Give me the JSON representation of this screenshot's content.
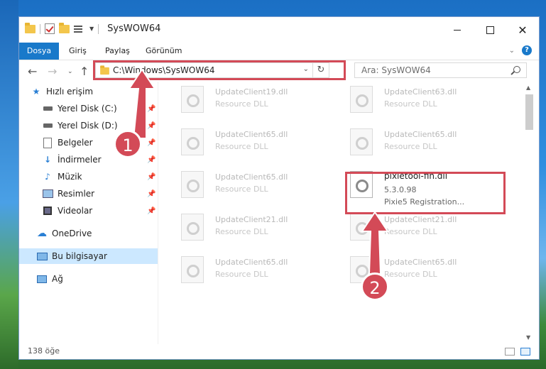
{
  "window": {
    "title": "SysWOW64"
  },
  "ribbon": {
    "tabs": [
      "Dosya",
      "Giriş",
      "Paylaş",
      "Görünüm"
    ]
  },
  "nav": {
    "address": "C:\\Windows\\SysWOW64",
    "search_placeholder": "Ara: SysWOW64"
  },
  "sidebar": {
    "items": [
      {
        "label": "Hızlı erişim",
        "icon": "star-icon"
      },
      {
        "label": "Yerel Disk (C:)",
        "icon": "drive-icon",
        "pinned": true
      },
      {
        "label": "Yerel Disk (D:)",
        "icon": "drive-icon",
        "pinned": true
      },
      {
        "label": "Belgeler",
        "icon": "documents-icon",
        "pinned": true
      },
      {
        "label": "İndirmeler",
        "icon": "download-icon",
        "pinned": true
      },
      {
        "label": "Müzik",
        "icon": "music-icon",
        "pinned": true
      },
      {
        "label": "Resimler",
        "icon": "pictures-icon",
        "pinned": true
      },
      {
        "label": "Videolar",
        "icon": "videos-icon",
        "pinned": true
      },
      {
        "label": "OneDrive",
        "icon": "cloud-icon"
      },
      {
        "label": "Bu bilgisayar",
        "icon": "computer-icon",
        "selected": true
      },
      {
        "label": "Ağ",
        "icon": "network-icon"
      }
    ]
  },
  "files": [
    {
      "name": "UpdateClient19.dll",
      "desc": "Resource DLL"
    },
    {
      "name": "UpdateClient63.dll",
      "desc": "Resource DLL"
    },
    {
      "name": "UpdateClient65.dll",
      "desc": "Resource DLL"
    },
    {
      "name": "UpdateClient65.dll",
      "desc": "Resource DLL"
    },
    {
      "name": "UpdateClient65.dll",
      "desc": "Resource DLL"
    },
    {
      "name": "pixietool-fin.dll",
      "version": "5.3.0.98",
      "desc": "Pixie5 Registration..."
    },
    {
      "name": "UpdateClient21.dll",
      "desc": "Resource DLL"
    },
    {
      "name": "UpdateClient21.dll",
      "desc": "Resource DLL"
    },
    {
      "name": "UpdateClient65.dll",
      "desc": "Resource DLL"
    },
    {
      "name": "UpdateClient65.dll",
      "desc": "Resource DLL"
    }
  ],
  "status": {
    "count": "138 öğe"
  },
  "annotations": {
    "step1": "1",
    "step2": "2",
    "color": "#d34a57"
  }
}
